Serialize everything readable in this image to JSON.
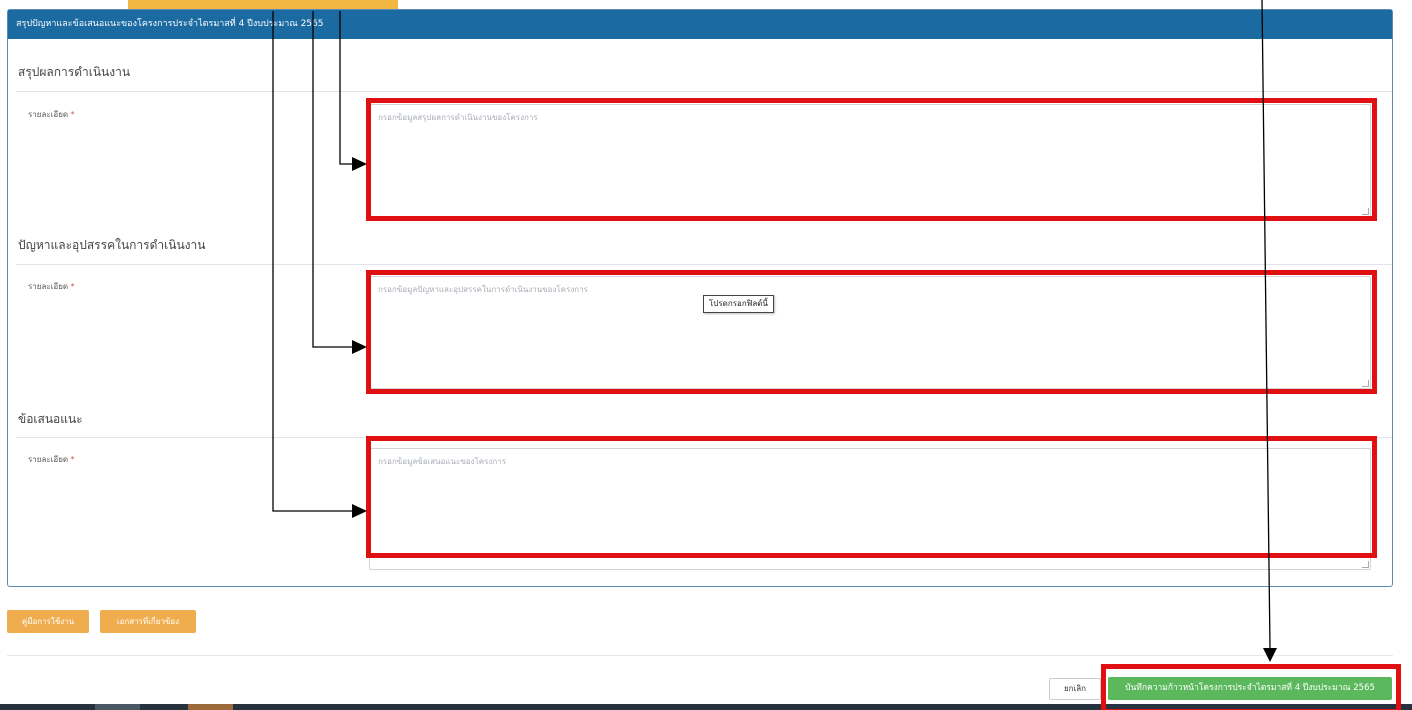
{
  "panel": {
    "header": "สรุปปัญหาและข้อเสนอแนะของโครงการประจำไตรมาสที่ 4 ปีงบประมาณ 2565"
  },
  "sections": [
    {
      "title": "สรุปผลการดำเนินงาน",
      "label": "รายละเอียด",
      "required": "*",
      "placeholder": "กรอกข้อมูลสรุปผลการดำเนินงานของโครงการ"
    },
    {
      "title": "ปัญหาและอุปสรรคในการดำเนินงาน",
      "label": "รายละเอียด",
      "required": "*",
      "placeholder": "กรอกข้อมูลปัญหาและอุปสรรคในการดำเนินงานของโครงการ"
    },
    {
      "title": "ข้อเสนอแนะ",
      "label": "รายละเอียด",
      "required": "*",
      "placeholder": "กรอกข้อมูลข้อเสนอแนะของโครงการ"
    }
  ],
  "tooltip": "โปรดกรอกฟิลด์นี้",
  "footer": {
    "manual_label": "คู่มือการใช้งาน",
    "documents_label": "เอกสารที่เกี่ยวข้อง",
    "cancel_label": "ยกเลิก",
    "save_label": "บันทึกความก้าวหน้าโครงการประจำไตรมาสที่ 4 ปีงบประมาณ 2565"
  },
  "colors": {
    "header_bg": "#1b6aa1",
    "save_button": "#5cb85c",
    "orange_button": "#f0ad4e",
    "annotation_red": "#e01010",
    "callout_yellow": "#f2b642"
  }
}
